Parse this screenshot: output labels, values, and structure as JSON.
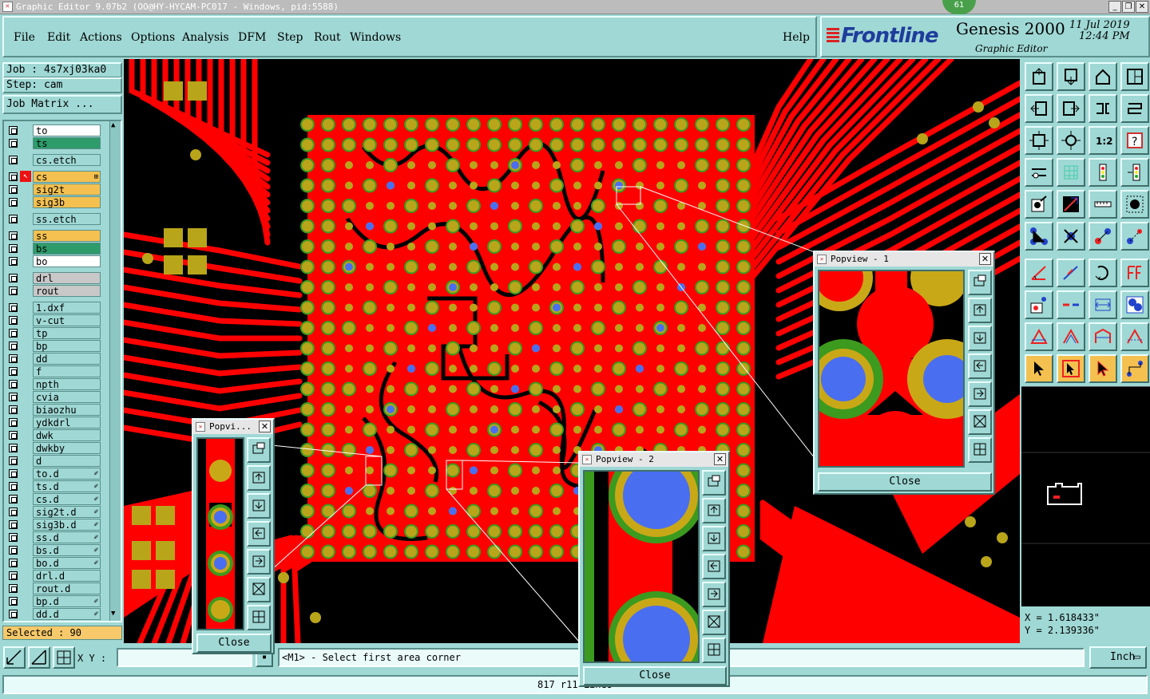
{
  "window": {
    "title": "Graphic Editor 9.07b2 (OO@HY-HYCAM-PC017 - Windows, pid:5588)",
    "badge": "61",
    "minimize": "_",
    "restore": "❐",
    "close": "✕"
  },
  "menu": [
    "File",
    "Edit",
    "Actions",
    "Options",
    "Analysis",
    "DFM",
    "Step",
    "Rout",
    "Windows"
  ],
  "help": "Help",
  "brand": {
    "logo": "Frontline",
    "product": "Genesis 2000",
    "subtitle": "Graphic Editor",
    "date": "11 Jul 2019",
    "time": "12:44 PM"
  },
  "job": {
    "job": "Job : 4s7xj03ka0",
    "step": "Step: cam",
    "matrix_button": "Job Matrix ..."
  },
  "layers": [
    {
      "name": "to",
      "color": "#ffffff"
    },
    {
      "name": "ts",
      "color": "#2e9b6b"
    },
    {
      "name": "cs.etch",
      "color": "#9fd8d4"
    },
    {
      "name": "cs",
      "color": "#f4c150",
      "tag": "⊞"
    },
    {
      "name": "sig2t",
      "color": "#f4c150"
    },
    {
      "name": "sig3b",
      "color": "#f4c150"
    },
    {
      "name": "ss.etch",
      "color": "#9fd8d4"
    },
    {
      "name": "ss",
      "color": "#f4c150"
    },
    {
      "name": "bs",
      "color": "#2e9b6b"
    },
    {
      "name": "bo",
      "color": "#ffffff"
    },
    {
      "name": "drl",
      "color": "#c8c8c8"
    },
    {
      "name": "rout",
      "color": "#c8c8c8"
    },
    {
      "name": "1.dxf",
      "color": "#9fd8d4"
    },
    {
      "name": "v-cut",
      "color": "#9fd8d4"
    },
    {
      "name": "tp",
      "color": "#9fd8d4"
    },
    {
      "name": "bp",
      "color": "#9fd8d4"
    },
    {
      "name": "dd",
      "color": "#9fd8d4"
    },
    {
      "name": "f",
      "color": "#9fd8d4"
    },
    {
      "name": "npth",
      "color": "#9fd8d4"
    },
    {
      "name": "cvia",
      "color": "#9fd8d4"
    },
    {
      "name": "biaozhu",
      "color": "#9fd8d4"
    },
    {
      "name": "ydkdrl",
      "color": "#9fd8d4"
    },
    {
      "name": "dwk",
      "color": "#9fd8d4"
    },
    {
      "name": "dwkby",
      "color": "#9fd8d4"
    },
    {
      "name": "d",
      "color": "#9fd8d4"
    },
    {
      "name": "to.d",
      "color": "#9fd8d4",
      "tag": "✐"
    },
    {
      "name": "ts.d",
      "color": "#9fd8d4",
      "tag": "✐"
    },
    {
      "name": "cs.d",
      "color": "#9fd8d4",
      "tag": "✐"
    },
    {
      "name": "sig2t.d",
      "color": "#9fd8d4",
      "tag": "✐"
    },
    {
      "name": "sig3b.d",
      "color": "#9fd8d4",
      "tag": "✐"
    },
    {
      "name": "ss.d",
      "color": "#9fd8d4",
      "tag": "✐"
    },
    {
      "name": "bs.d",
      "color": "#9fd8d4",
      "tag": "✐"
    },
    {
      "name": "bo.d",
      "color": "#9fd8d4",
      "tag": "✐"
    },
    {
      "name": "drl.d",
      "color": "#9fd8d4"
    },
    {
      "name": "rout.d",
      "color": "#9fd8d4"
    },
    {
      "name": "bp.d",
      "color": "#9fd8d4",
      "tag": "✐"
    },
    {
      "name": "dd.d",
      "color": "#9fd8d4",
      "tag": "✐"
    }
  ],
  "selected": "Selected : 90",
  "coords": {
    "x": "X = 1.618433\"",
    "y": "Y = 2.139336\""
  },
  "bottom": {
    "xy_label": "X Y :",
    "xy_value": "",
    "message": "<M1> - Select first area corner",
    "units": "Inch",
    "status": "817 r11 Lines"
  },
  "popviews": [
    {
      "title": "Popview - 1",
      "close": "Close"
    },
    {
      "title": "Popview - 2",
      "close": "Close"
    },
    {
      "title": "Popvi...",
      "close": "Close"
    }
  ],
  "colors": {
    "copper": "#ff0000",
    "pad": "#b8a51a",
    "via": "#4a6ef0",
    "mask": "#3c9a1e",
    "panel": "#9fd8d4",
    "active": "#f4c150"
  }
}
